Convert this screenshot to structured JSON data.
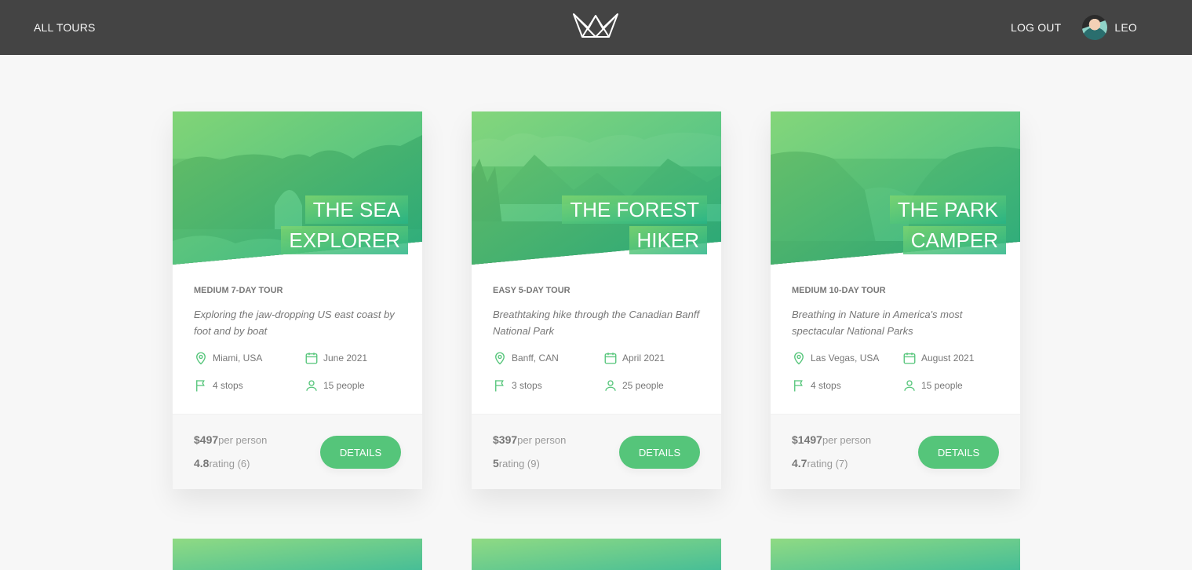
{
  "header": {
    "left_link": "All tours",
    "logout": "Log out",
    "user_name": "Leo"
  },
  "tours": [
    {
      "title_line1": "The Sea",
      "title_line2": "Explorer",
      "subheading": "Medium 7-day tour",
      "summary": "Exploring the jaw-dropping US east coast by foot and by boat",
      "location": "Miami, USA",
      "date": "June 2021",
      "stops": "4 stops",
      "people": "15 people",
      "price": "$497",
      "price_unit": "per person",
      "rating": "4.8",
      "rating_label": "rating (6)",
      "button": "Details"
    },
    {
      "title_line1": "The Forest",
      "title_line2": "Hiker",
      "subheading": "Easy 5-day tour",
      "summary": "Breathtaking hike through the Canadian Banff National Park",
      "location": "Banff, CAN",
      "date": "April 2021",
      "stops": "3 stops",
      "people": "25 people",
      "price": "$397",
      "price_unit": "per person",
      "rating": "5",
      "rating_label": "rating (9)",
      "button": "Details"
    },
    {
      "title_line1": "The Park",
      "title_line2": "Camper",
      "subheading": "Medium 10-day tour",
      "summary": "Breathing in Nature in America's most spectacular National Parks",
      "location": "Las Vegas, USA",
      "date": "August 2021",
      "stops": "4 stops",
      "people": "15 people",
      "price": "$1497",
      "price_unit": "per person",
      "rating": "4.7",
      "rating_label": "rating (7)",
      "button": "Details"
    }
  ],
  "colors": {
    "header_bg": "#444444",
    "accent": "#55c57a",
    "gradient_light": "#7dd56f",
    "gradient_dark": "#28b485",
    "page_bg": "#f7f7f7"
  },
  "icons": {
    "location": "map-pin-icon",
    "date": "calendar-icon",
    "stops": "flag-icon",
    "people": "user-icon",
    "logo": "crown-logo"
  }
}
